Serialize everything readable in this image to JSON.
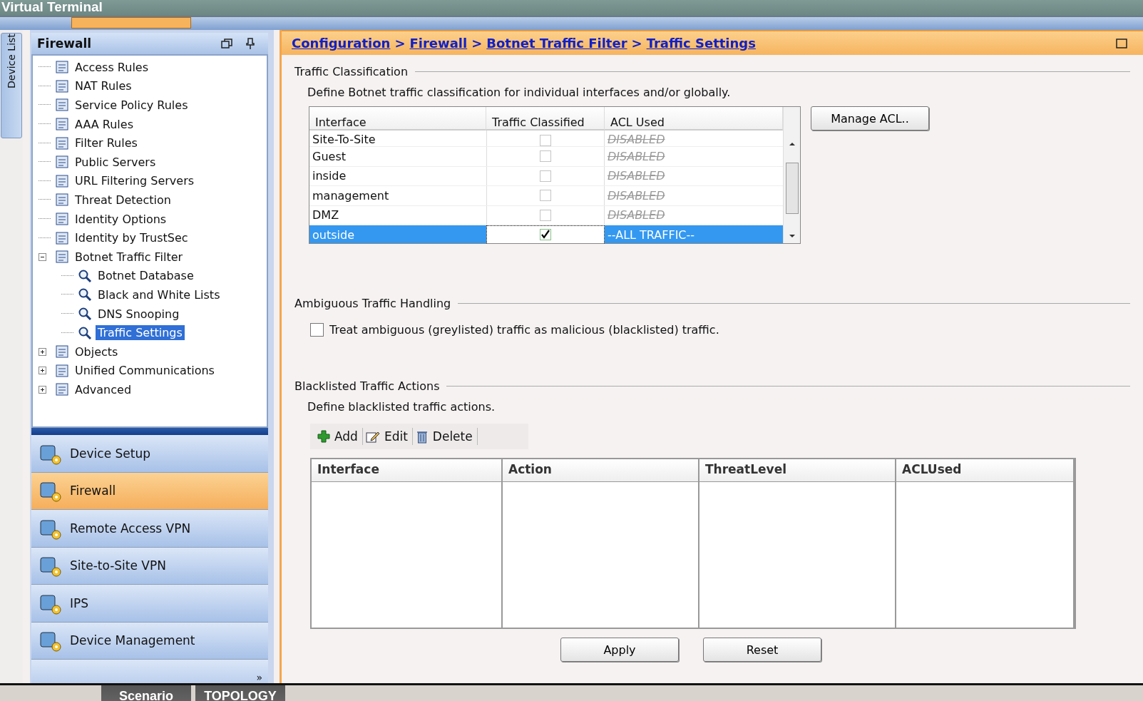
{
  "window": {
    "title": "Virtual Terminal"
  },
  "device_list_tab": {
    "label": "Device List"
  },
  "sidebar": {
    "title": "Firewall",
    "tree": [
      {
        "label": "Access Rules",
        "selected": false
      },
      {
        "label": "NAT Rules",
        "selected": false
      },
      {
        "label": "Service Policy Rules",
        "selected": false
      },
      {
        "label": "AAA Rules",
        "selected": false
      },
      {
        "label": "Filter Rules",
        "selected": false
      },
      {
        "label": "Public Servers",
        "selected": false
      },
      {
        "label": "URL Filtering Servers",
        "selected": false
      },
      {
        "label": "Threat Detection",
        "selected": false
      },
      {
        "label": "Identity Options",
        "selected": false
      },
      {
        "label": "Identity by TrustSec",
        "selected": false
      },
      {
        "label": "Botnet Traffic Filter",
        "selected": false,
        "expanded": true,
        "children": [
          {
            "label": "Botnet Database",
            "selected": false
          },
          {
            "label": "Black and White Lists",
            "selected": false
          },
          {
            "label": "DNS Snooping",
            "selected": false
          },
          {
            "label": "Traffic Settings",
            "selected": true
          }
        ]
      },
      {
        "label": "Objects",
        "selected": false,
        "expanded": false
      },
      {
        "label": "Unified Communications",
        "selected": false,
        "expanded": false
      },
      {
        "label": "Advanced",
        "selected": false,
        "expanded": false
      }
    ],
    "nav": [
      {
        "label": "Device Setup",
        "selected": false
      },
      {
        "label": "Firewall",
        "selected": true
      },
      {
        "label": "Remote Access VPN",
        "selected": false
      },
      {
        "label": "Site-to-Site VPN",
        "selected": false
      },
      {
        "label": "IPS",
        "selected": false
      },
      {
        "label": "Device Management",
        "selected": false
      }
    ],
    "more": "»"
  },
  "breadcrumb": [
    "Configuration",
    "Firewall",
    "Botnet Traffic Filter",
    "Traffic Settings"
  ],
  "breadcrumb_separator": ">",
  "traffic_classification": {
    "title": "Traffic Classification",
    "description": "Define Botnet traffic classification for individual interfaces and/or globally.",
    "columns": [
      "Interface",
      "Traffic Classified",
      "ACL Used"
    ],
    "rows": [
      {
        "interface": "Site-To-Site",
        "classified": false,
        "acl": "DISABLED",
        "acl_disabled": true,
        "selected": false
      },
      {
        "interface": "Guest",
        "classified": false,
        "acl": "DISABLED",
        "acl_disabled": true,
        "selected": false
      },
      {
        "interface": "inside",
        "classified": false,
        "acl": "DISABLED",
        "acl_disabled": true,
        "selected": false
      },
      {
        "interface": "management",
        "classified": false,
        "acl": "DISABLED",
        "acl_disabled": true,
        "selected": false
      },
      {
        "interface": "DMZ",
        "classified": false,
        "acl": "DISABLED",
        "acl_disabled": true,
        "selected": false
      },
      {
        "interface": "outside",
        "classified": true,
        "acl": "--ALL TRAFFIC--",
        "acl_disabled": false,
        "selected": true
      }
    ],
    "manage_button": "Manage ACL.."
  },
  "ambiguous": {
    "title": "Ambiguous Traffic Handling",
    "checkbox_label": "Treat ambiguous (greylisted) traffic as malicious (blacklisted) traffic.",
    "checked": false
  },
  "blacklisted": {
    "title": "Blacklisted Traffic Actions",
    "description": "Define blacklisted traffic actions.",
    "toolbar": [
      {
        "kind": "add",
        "label": "Add"
      },
      {
        "kind": "edit",
        "label": "Edit"
      },
      {
        "kind": "delete",
        "label": "Delete"
      }
    ],
    "columns": [
      "Interface",
      "Action",
      "ThreatLevel",
      "ACLUsed"
    ]
  },
  "buttons": [
    "Apply",
    "Reset"
  ],
  "bottom_tabs": [
    "Scenario",
    "TOPOLOGY"
  ]
}
